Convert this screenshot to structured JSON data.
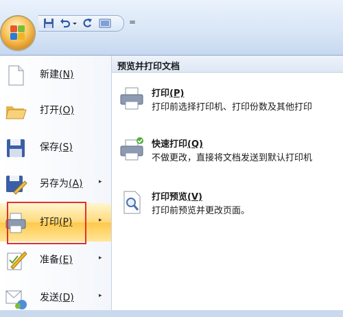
{
  "quick_access": {
    "buttons": [
      "save-icon",
      "undo-icon",
      "redo-icon",
      "print-preview-icon"
    ],
    "more": "="
  },
  "left_menu": {
    "items": [
      {
        "label": "新建",
        "key": "(N)",
        "icon": "new-document-icon",
        "submenu": false
      },
      {
        "label": "打开",
        "key": "(O)",
        "icon": "open-folder-icon",
        "submenu": false
      },
      {
        "label": "保存",
        "key": "(S)",
        "icon": "save-icon",
        "submenu": false
      },
      {
        "label": "另存为",
        "key": "(A)",
        "icon": "save-as-icon",
        "submenu": true
      },
      {
        "label": "打印",
        "key": "(P)",
        "icon": "printer-icon",
        "submenu": true,
        "active": true
      },
      {
        "label": "准备",
        "key": "(E)",
        "icon": "prepare-icon",
        "submenu": true
      },
      {
        "label": "发送",
        "key": "(D)",
        "icon": "send-icon",
        "submenu": true
      }
    ],
    "arrow": "▸"
  },
  "right_pane": {
    "header": "预览并打印文档",
    "items": [
      {
        "title": "打印",
        "key": "(P)",
        "desc": "打印前选择打印机、打印份数及其他打印",
        "icon": "printer-icon"
      },
      {
        "title": "快速打印",
        "key": "(Q)",
        "desc": "不做更改，直接将文档发送到默认打印机",
        "icon": "quick-print-icon"
      },
      {
        "title": "打印预览",
        "key": "(V)",
        "desc": "打印前预览并更改页面。",
        "icon": "print-preview-icon"
      }
    ]
  },
  "colors": {
    "highlight": "#ffd978",
    "annotation_box": "#e03030",
    "accent": "#1e5aa8"
  }
}
